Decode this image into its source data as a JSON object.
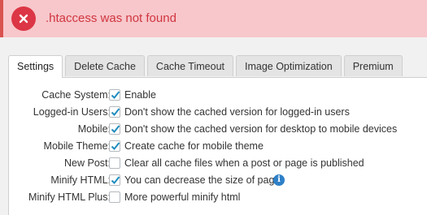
{
  "notice": {
    "message": ".htaccess was not found",
    "icon": "error-x-icon",
    "color": "#dc3545"
  },
  "tabs": [
    {
      "label": "Settings",
      "active": true
    },
    {
      "label": "Delete Cache",
      "active": false
    },
    {
      "label": "Cache Timeout",
      "active": false
    },
    {
      "label": "Image Optimization",
      "active": false
    },
    {
      "label": "Premium",
      "active": false
    }
  ],
  "settings": [
    {
      "label": "Cache System:",
      "checked": true,
      "description": "Enable"
    },
    {
      "label": "Logged-in Users:",
      "checked": true,
      "description": "Don't show the cached version for logged-in users"
    },
    {
      "label": "Mobile:",
      "checked": true,
      "description": "Don't show the cached version for desktop to mobile devices"
    },
    {
      "label": "Mobile Theme:",
      "checked": true,
      "description": "Create cache for mobile theme"
    },
    {
      "label": "New Post:",
      "checked": false,
      "description": "Clear all cache files when a post or page is published"
    },
    {
      "label": "Minify HTML:",
      "checked": true,
      "description": "You can decrease the size of page",
      "info_icon": "info-icon"
    },
    {
      "label": "Minify HTML Plus:",
      "checked": false,
      "description": "More powerful minify html"
    }
  ]
}
